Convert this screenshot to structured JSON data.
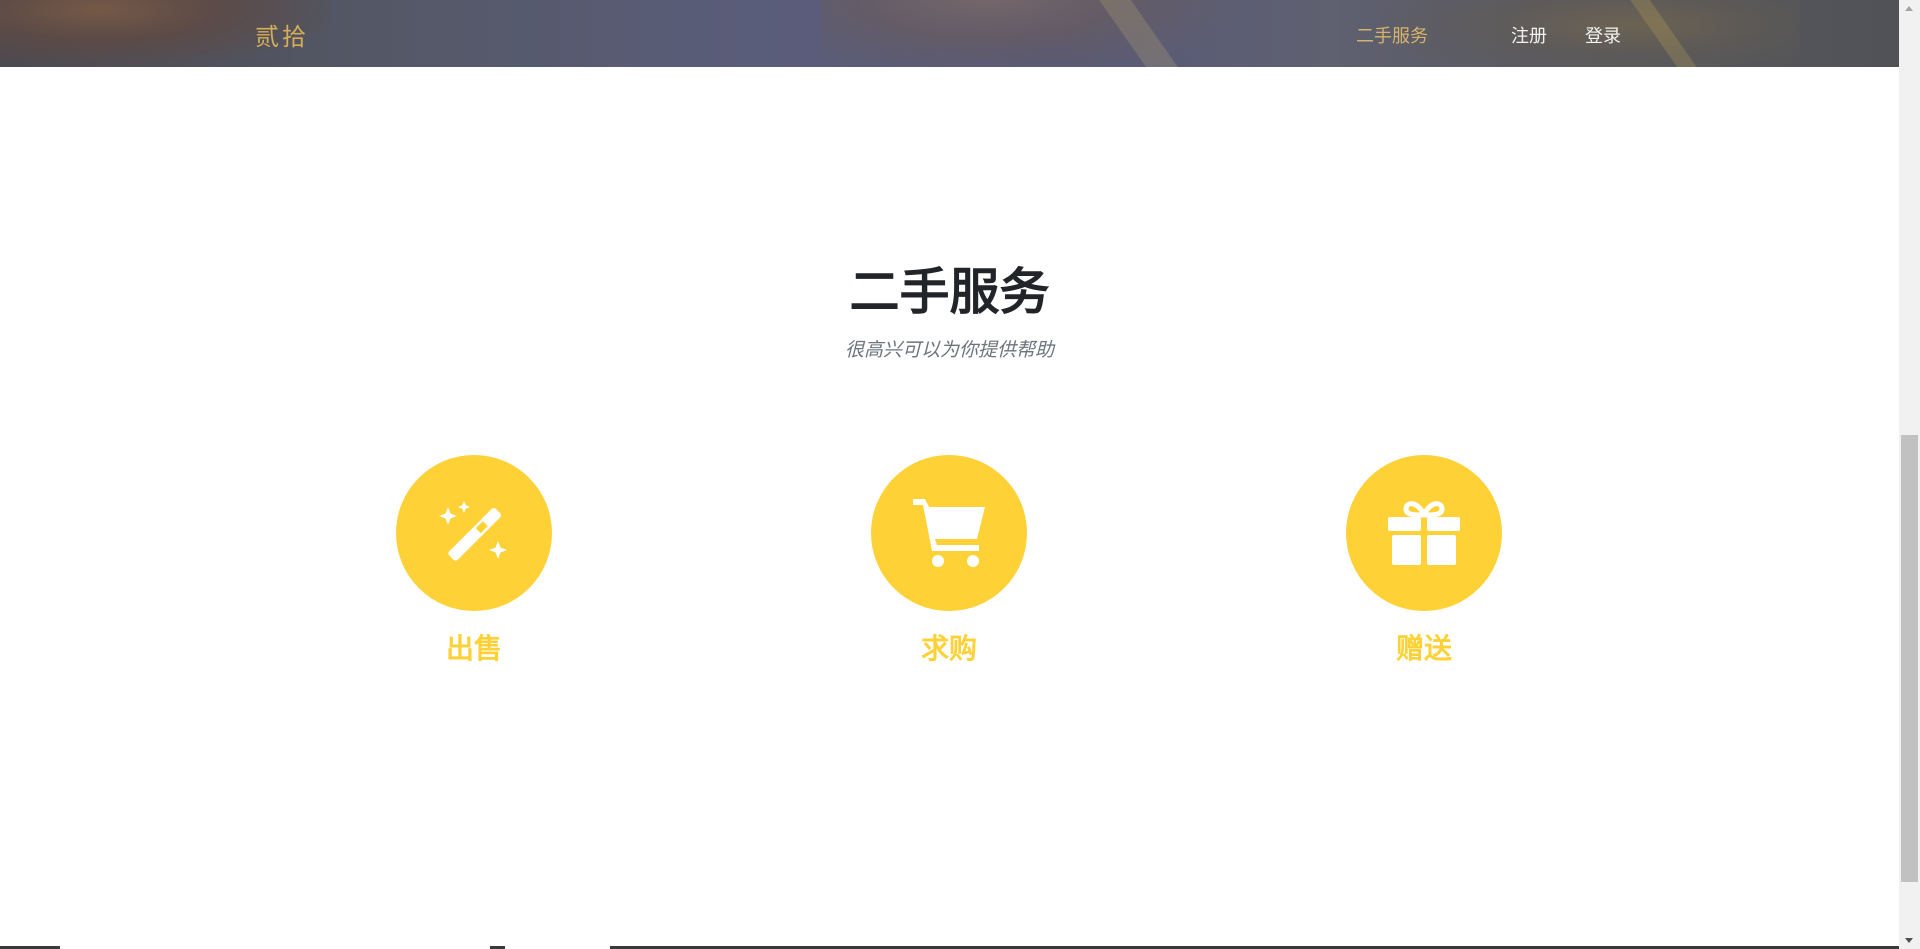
{
  "navbar": {
    "brand": "贰拾",
    "links": [
      {
        "label": "二手服务",
        "active": true
      },
      {
        "label": "注册",
        "active": false
      },
      {
        "label": "登录",
        "active": false
      }
    ]
  },
  "services_section": {
    "title": "二手服务",
    "subtitle": "很高兴可以为你提供帮助",
    "items": [
      {
        "label": "出售",
        "icon": "magic-wand-icon"
      },
      {
        "label": "求购",
        "icon": "shopping-cart-icon"
      },
      {
        "label": "赠送",
        "icon": "gift-icon"
      }
    ]
  },
  "colors": {
    "accent": "#fed136",
    "brand": "#d4ae5a",
    "title": "#212529",
    "subtitle": "#6c757d"
  }
}
